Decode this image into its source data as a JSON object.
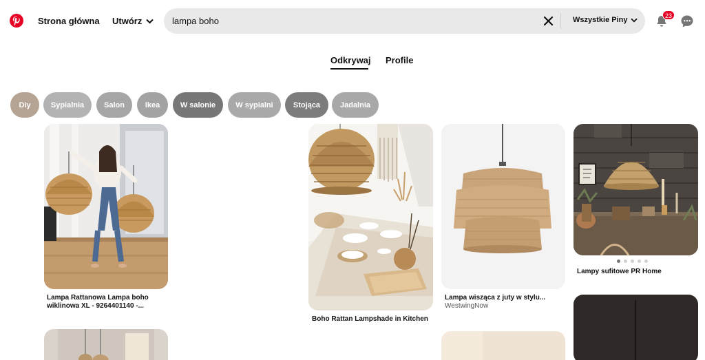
{
  "header": {
    "home_label": "Strona główna",
    "create_label": "Utwórz",
    "search_value": "lampa boho",
    "filter_label": "Wszystkie Piny",
    "notifications_count": "23",
    "brand_color": "#e60023"
  },
  "tabs": [
    {
      "label": "Odkrywaj",
      "active": true
    },
    {
      "label": "Profile",
      "active": false
    }
  ],
  "chips": [
    {
      "label": "Diy",
      "color": "#b5a393"
    },
    {
      "label": "Sypialnia",
      "color": "#b3b3b3"
    },
    {
      "label": "Salon",
      "color": "#a6a6a6"
    },
    {
      "label": "Ikea",
      "color": "#a3a3a3"
    },
    {
      "label": "W salonie",
      "color": "#777777"
    },
    {
      "label": "W sypialni",
      "color": "#a9a9a9"
    },
    {
      "label": "Stojąca",
      "color": "#7c7c7c"
    },
    {
      "label": "Jadalnia",
      "color": "#a8a8a8"
    }
  ],
  "pins": [
    {
      "title": "Lampa Rattanowa Lampa boho wiklinowa XL - 9264401140 -...",
      "source": ""
    },
    {
      "title": "Boho Rattan Lampshade in Kitchen",
      "source": ""
    },
    {
      "title": "Lampa wisząca z juty w stylu...",
      "source": "WestwingNow"
    },
    {
      "title": "Lampy sufitowe PR Home",
      "source": ""
    }
  ],
  "carousel": {
    "total": 5,
    "active": 1
  }
}
